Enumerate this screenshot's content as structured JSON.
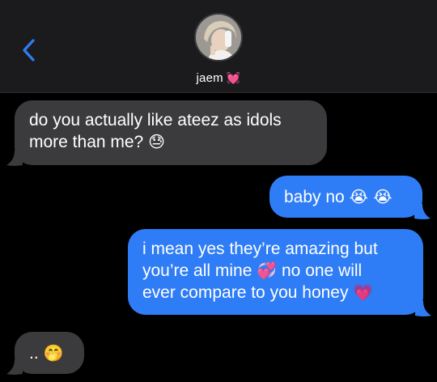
{
  "header": {
    "contact_name": "jaem",
    "contact_emoji": "💓",
    "back_icon": "chevron-left-icon",
    "accent_color": "#2f7df6"
  },
  "messages": [
    {
      "direction": "incoming",
      "line1": "do you actually like ateez as idols",
      "line2": "more than me?",
      "emoji": "😓"
    },
    {
      "direction": "outgoing",
      "text": "baby no",
      "emoji": "😭 😭"
    },
    {
      "direction": "outgoing",
      "line1": "i mean yes they’re amazing but",
      "line2a": "you’re all mine",
      "emoji_mid": "💞",
      "line2b": "no one will",
      "line3": "ever compare to you honey",
      "emoji_end": "💗"
    },
    {
      "direction": "incoming",
      "text": "..",
      "emoji": "🤭"
    }
  ],
  "colors": {
    "incoming_bubble": "#3b3b3d",
    "outgoing_bubble": "#2f7df6",
    "header_bg": "#1b1b1d",
    "background": "#000000"
  }
}
